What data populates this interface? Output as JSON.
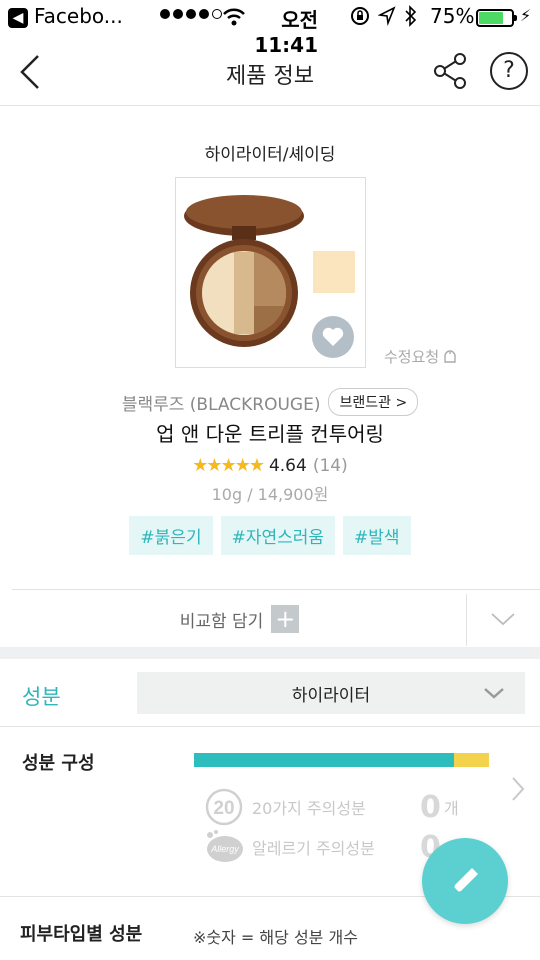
{
  "status_bar": {
    "app_name": "Facebo...",
    "time": "오전 11:41",
    "battery_pct": "75%",
    "battery_level": 0.75
  },
  "nav": {
    "title": "제품 정보"
  },
  "product": {
    "category": "하이라이터/셰이딩",
    "brand": "블랙루즈 (BLACKROUGE)",
    "brand_button": "브랜드관 >",
    "name": "업 앤 다운 트리플 컨투어링",
    "rating": "4.64",
    "rating_value": 4.64,
    "review_count": "(14)",
    "price": "10g / 14,900원",
    "swatch_color": "#fbe5bf",
    "edit_request": "수정요청",
    "tags": [
      "#붉은기",
      "#자연스러움",
      "#발색"
    ]
  },
  "compare": {
    "label": "비교함 담기"
  },
  "ingredients": {
    "label": "성분",
    "selected": "하이라이터",
    "composition_label": "성분 구성",
    "bar_fraction": 0.88,
    "row1_text": "20가지 주의성분",
    "row1_count": "0",
    "row1_unit": "개",
    "row2_text": "알레르기 주의성분",
    "row2_count": "0",
    "row2_icon_text": "Allergy",
    "badge20": "20"
  },
  "skin": {
    "label": "피부타입별 성분",
    "note": "※숫자 = 해당 성분 개수"
  },
  "colors": {
    "accent": "#2eb6bb",
    "fab": "#5ccfd0",
    "star": "#f5b920",
    "bar_main": "#2ebdbd",
    "bar_rest": "#f3d24c"
  }
}
